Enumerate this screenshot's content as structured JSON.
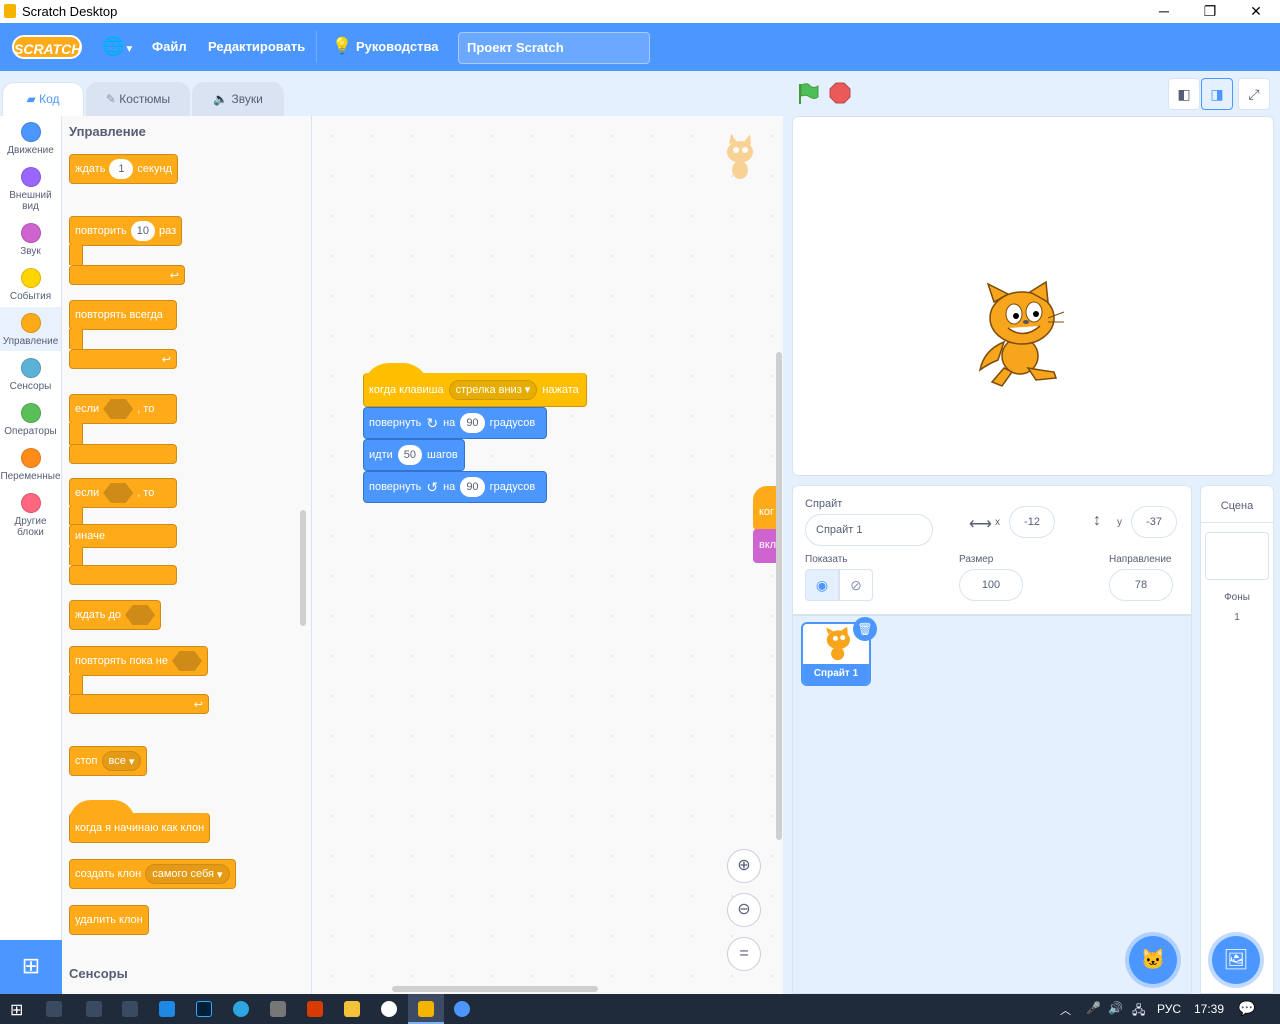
{
  "window": {
    "title": "Scratch Desktop",
    "min": "─",
    "max": "❐",
    "close": "✕"
  },
  "menu": {
    "logo": "SCRATCH",
    "file": "Файл",
    "edit": "Редактировать",
    "tutorials": "Руководства",
    "project_title": "Проект Scratch"
  },
  "tabs": {
    "code": "Код",
    "costumes": "Костюмы",
    "sounds": "Звуки"
  },
  "categories": [
    {
      "label": "Движение",
      "color": "#4c97ff"
    },
    {
      "label": "Внешний вид",
      "color": "#9966ff"
    },
    {
      "label": "Звук",
      "color": "#cf63cf"
    },
    {
      "label": "События",
      "color": "#ffd500"
    },
    {
      "label": "Управление",
      "color": "#ffab19"
    },
    {
      "label": "Сенсоры",
      "color": "#5cb1d6"
    },
    {
      "label": "Операторы",
      "color": "#59c059"
    },
    {
      "label": "Переменные",
      "color": "#ff8c1a"
    },
    {
      "label": "Другие блоки",
      "color": "#ff6680"
    }
  ],
  "palette": {
    "heading": "Управление",
    "wait": {
      "a": "ждать",
      "n": "1",
      "b": "секунд"
    },
    "repeat": {
      "a": "повторить",
      "n": "10",
      "b": "раз"
    },
    "forever": "повторять всегда",
    "if_then": {
      "a": "если",
      "b": ", то"
    },
    "if_else": {
      "a": "если",
      "b": ", то",
      "c": "иначе"
    },
    "wait_until": "ждать до",
    "repeat_until": "повторять пока не",
    "stop": {
      "a": "стоп",
      "opt": "все"
    },
    "clone_start": "когда я начинаю как клон",
    "create_clone": {
      "a": "создать клон",
      "opt": "самого себя"
    },
    "delete_clone": "удалить клон",
    "next_heading": "Сенсоры"
  },
  "script": {
    "hat": {
      "a": "когда клавиша",
      "opt": "стрелка вниз",
      "b": "нажата"
    },
    "turn_right": {
      "a": "повернуть",
      "b": "на",
      "n": "90",
      "c": "градусов"
    },
    "move": {
      "a": "идти",
      "n": "50",
      "b": "шагов"
    },
    "turn_left": {
      "a": "повернуть",
      "b": "на",
      "n": "90",
      "c": "градусов"
    },
    "offscreen1": "ког",
    "offscreen2": "вкл"
  },
  "sprite": {
    "label": "Спрайт",
    "name": "Спрайт 1",
    "x_label": "x",
    "x": "-12",
    "y_label": "y",
    "y": "-37",
    "show_label": "Показать",
    "size_label": "Размер",
    "size": "100",
    "dir_label": "Направление",
    "direction": "78"
  },
  "sprite_thumb": {
    "name": "Спрайт 1"
  },
  "stage_panel": {
    "title": "Сцена",
    "backdrops_label": "Фоны",
    "backdrops_count": "1"
  },
  "taskbar": {
    "lang": "РУС",
    "time": "17:39"
  }
}
